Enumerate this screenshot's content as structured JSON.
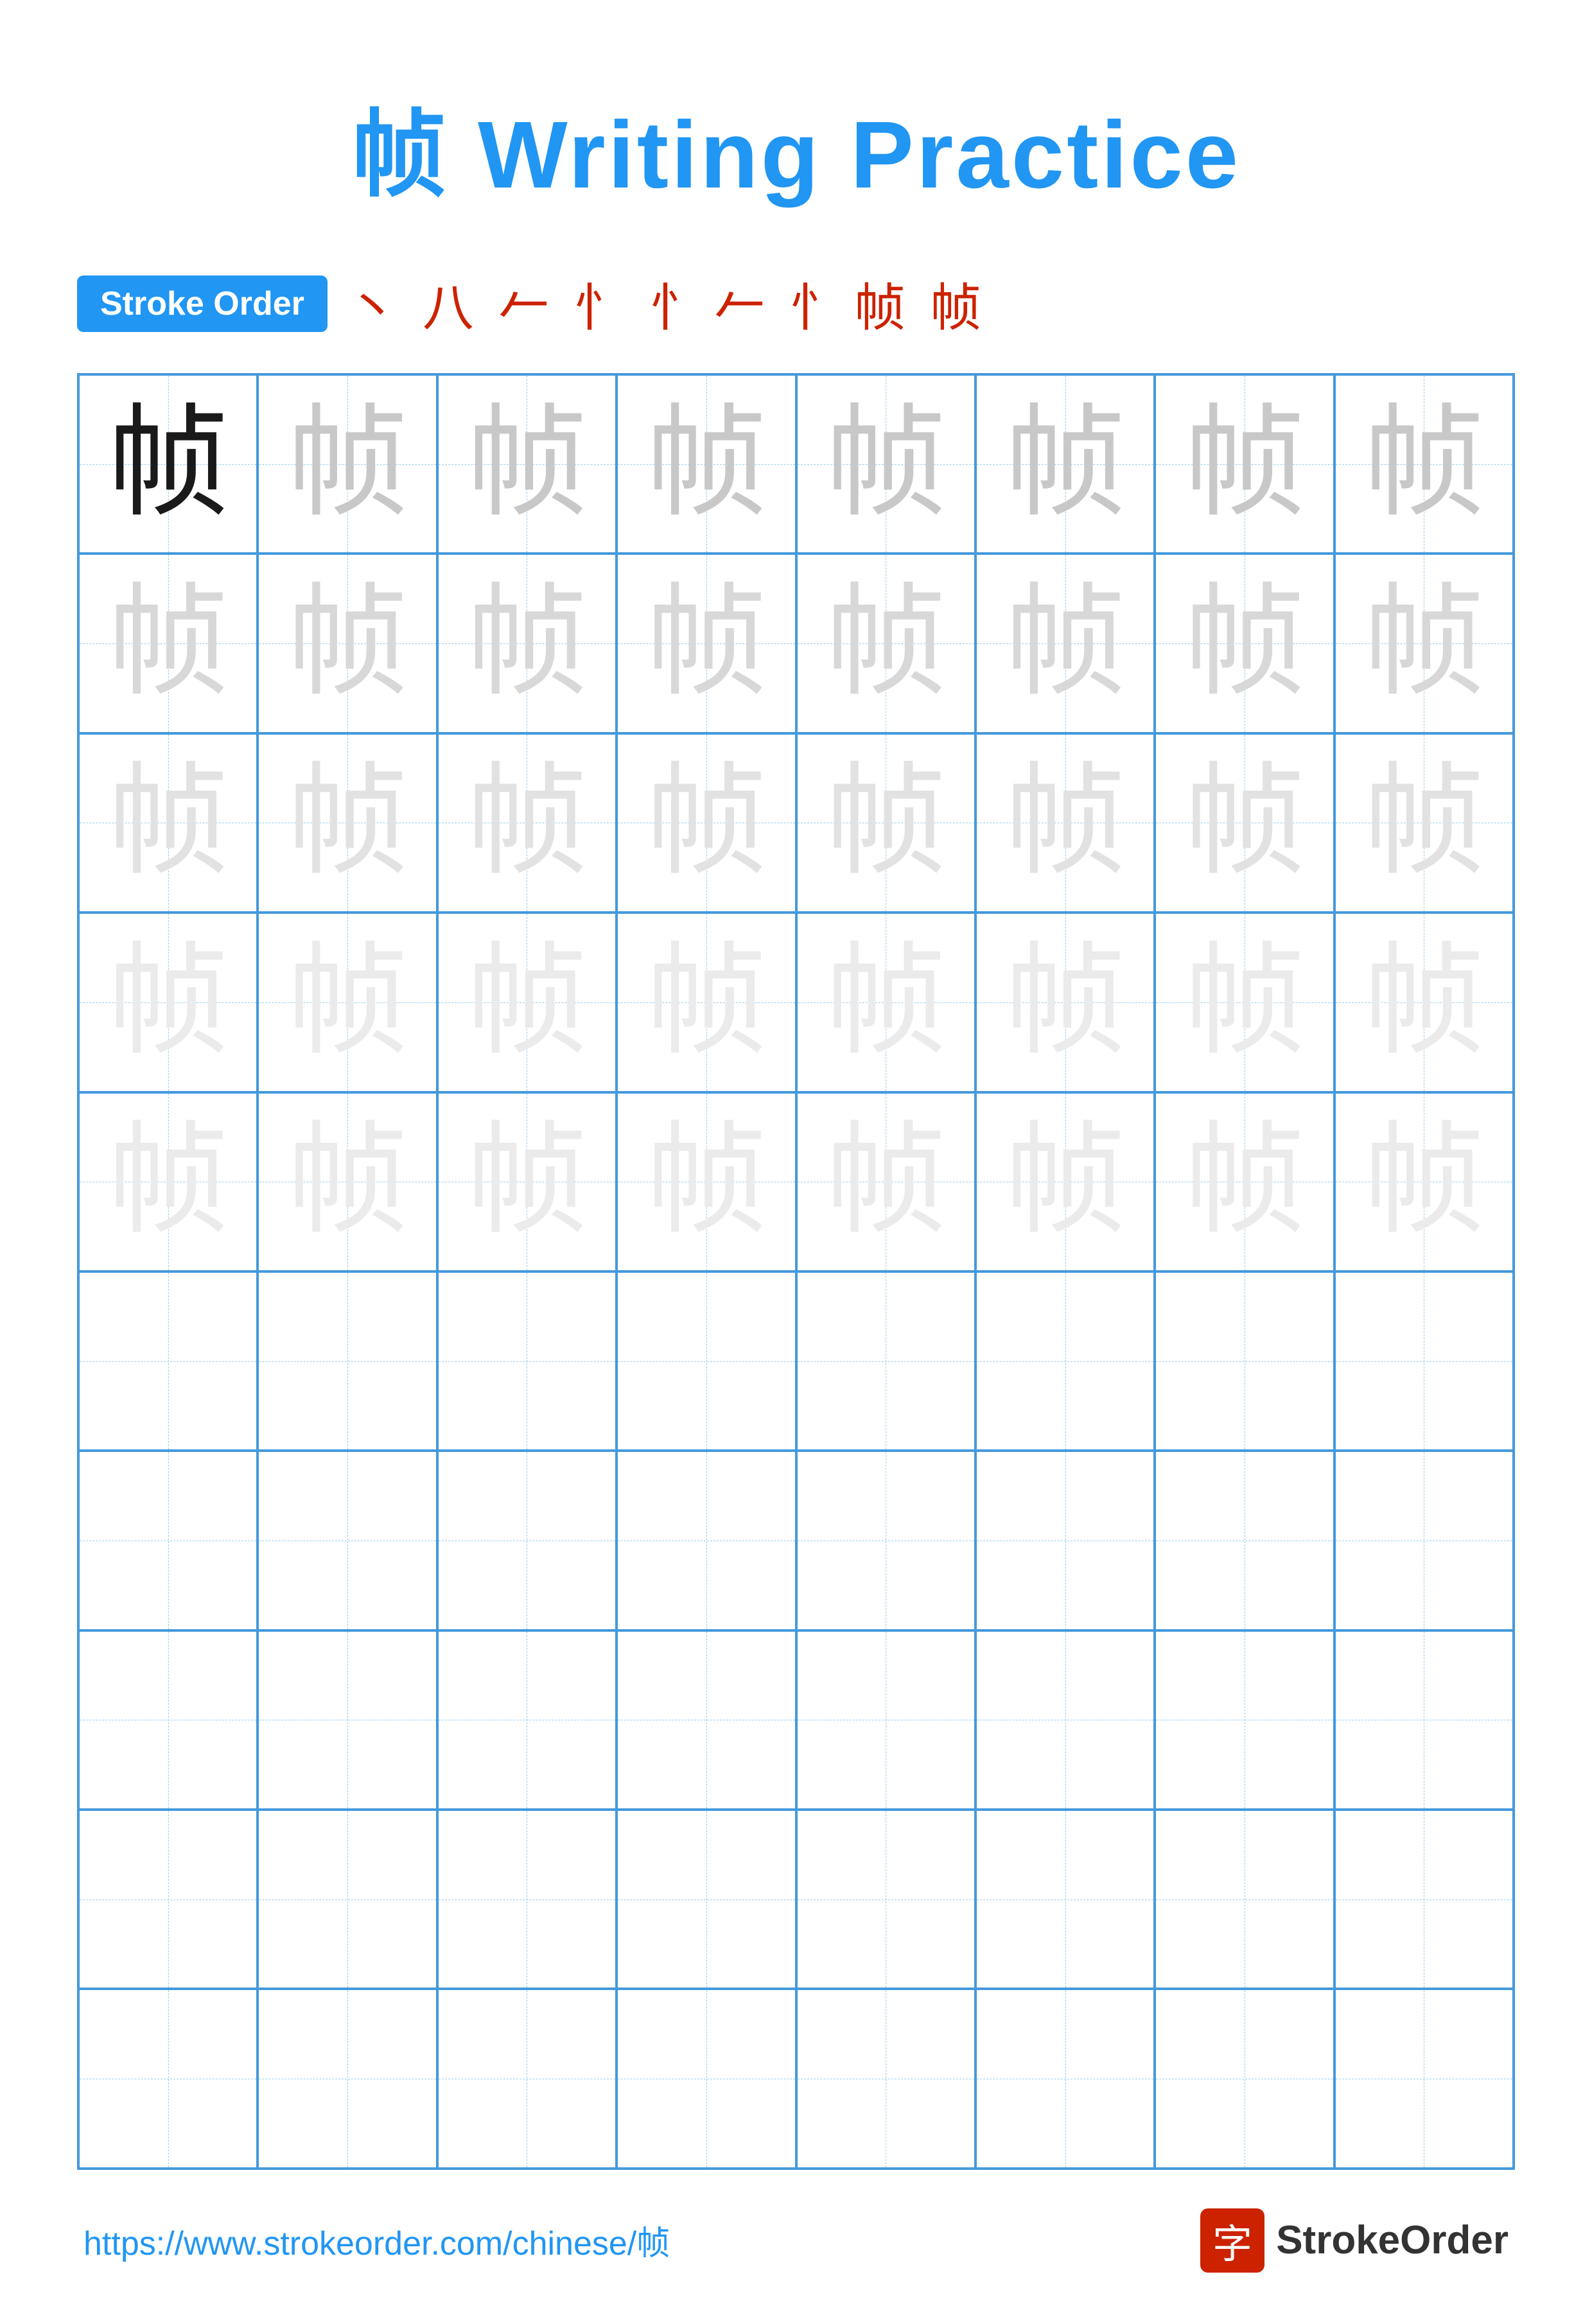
{
  "title": "帧 Writing Practice",
  "stroke_order_badge": "Stroke Order",
  "stroke_sequence": [
    "丶",
    "八",
    "𠂉",
    "忄",
    "忄",
    "忄帧",
    "帧"
  ],
  "character": "帧",
  "url": "https://www.strokeorder.com/chinese/帧",
  "logo_char": "字",
  "logo_text": "StrokeOrder",
  "grid": {
    "rows": 10,
    "cols": 8
  }
}
